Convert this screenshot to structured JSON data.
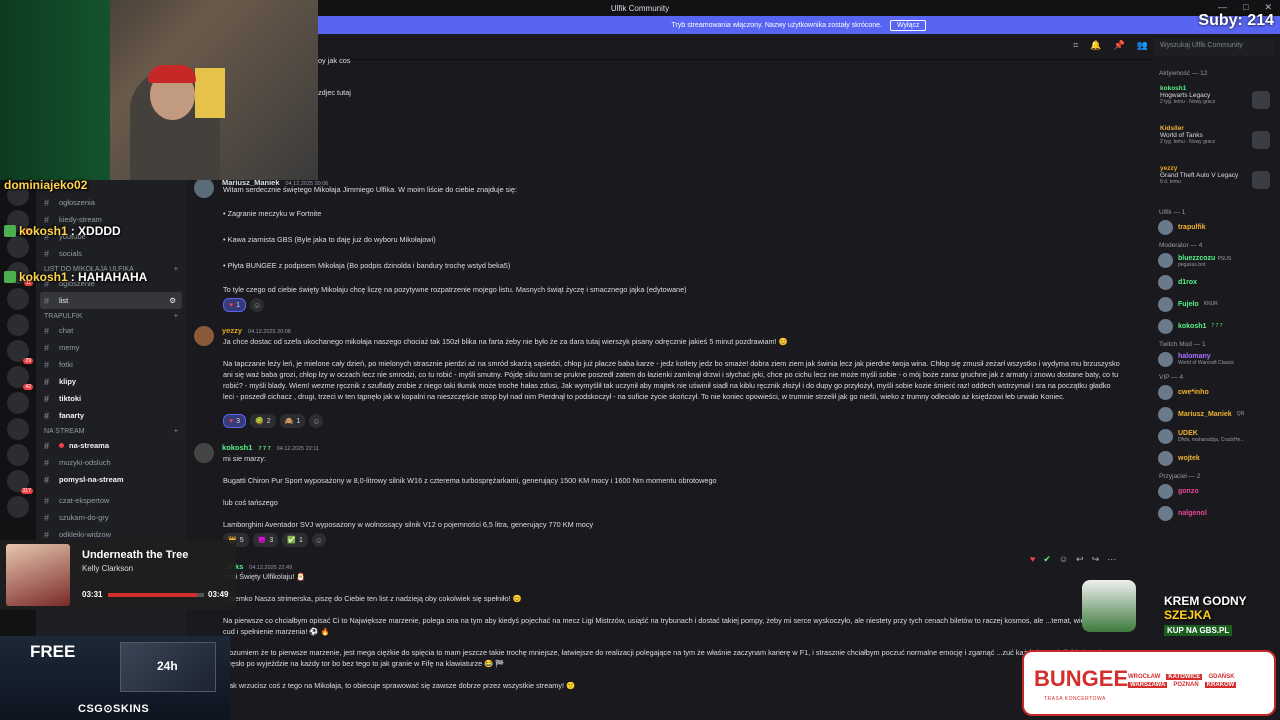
{
  "window": {
    "title": "Ulfik Community",
    "controls": [
      "—",
      "□",
      "✕"
    ]
  },
  "subs_counter": "Suby: 214",
  "stream_banner": {
    "text": "Tryb streamowania włączony. Nazwy użytkownika zostały skrócone.",
    "button": "Wyłącz"
  },
  "search": {
    "placeholder": "Wyszukaj Ulfik Community"
  },
  "top_fragments": [
    "oy jak cos",
    "zdjec tutaj"
  ],
  "channels": {
    "top_items": [
      {
        "label": "ogłoszenia"
      },
      {
        "label": "kiedy-stream"
      },
      {
        "label": "youtube"
      },
      {
        "label": "socials"
      }
    ],
    "cat_list": "LIST DO MIKOŁAJA ULFIKA",
    "list_items": [
      {
        "label": "ogloszenie",
        "active": false
      },
      {
        "label": "list",
        "active": true
      }
    ],
    "cat_trap": "TRAPULFIK",
    "trap_items": [
      {
        "label": "chat",
        "bold": false
      },
      {
        "label": "memy",
        "bold": false
      },
      {
        "label": "fotki",
        "bold": false
      },
      {
        "label": "klipy",
        "bold": true
      },
      {
        "label": "tiktoki",
        "bold": true
      },
      {
        "label": "fanarty",
        "bold": true
      }
    ],
    "cat_stream": "NA STREAM",
    "stream_items": [
      {
        "label": "na-streama",
        "bold": true
      },
      {
        "label": "muzyki-odsluch",
        "bold": false
      },
      {
        "label": "pomysl-na-stream",
        "bold": true
      }
    ],
    "bottom_items": [
      {
        "label": "czat-ekspertow"
      },
      {
        "label": "szukam-do-gry"
      },
      {
        "label": "odkleiki-widzow"
      }
    ]
  },
  "stream_chat": [
    {
      "name": "dominiajeko02",
      "text": ""
    },
    {
      "name": "kokosh1",
      "text": ": XDDDD"
    },
    {
      "name": "kokosh1",
      "text": ": HAHAHAHA"
    }
  ],
  "messages": [
    {
      "author": "Mariusz_Maniek",
      "time": "04.12.2025 20:06",
      "color": "#dbdee1",
      "lines": [
        "Witam serdecznie świętego Mikołaja Jimmiego Ulfika. W moim liście do ciebie znajduje się:",
        "•   Zagranie meczyku w Fortnite",
        "•   Kawa ziarnista GBS (Byle jaka to daję już do wyboru Mikołajowi)",
        "•   Płyta BUNGEE z podpisem Mikołaja (Bo podpis dzinolda i bandury trochę wstyd beka5)",
        "To tyle czego od ciebie święty Mikołaju chcę liczę na pozytywne rozpatrzenie mojego listu. Masnych świąt życzę i smacznego jajka (edytowane)"
      ],
      "reactions": [
        {
          "emoji": "♥",
          "count": "1",
          "selected": true
        }
      ]
    },
    {
      "author": "yezzy",
      "time": "04.12.2025 20:08",
      "color": "#e6a817",
      "lines": [
        "Ja chce dostac od szefa ukochanego mikołaja naszego chociaż tak 150zł blika na farta żeby nie było że za dara tutaj wierszyk pisany odręcznie jakieś 5 minut pozdrawiam! 😊",
        "Na tapczanie leży leń, je mielone cały dzień, po mielonych strasznie pierdzi aż na smród skarżą sąsiedzi, chłop już płacze baba karze - jedz kotlety jedz bo smaże! dobra ziem ziem jak świnia lecz jak pierdne twoja wina. Chłop się zmusił zeżarł wszystko i wydyma mu brzuszysko ani się waż baba grozi, chłop łzy w oczach lecz nie smrodzi, co tu robić - myśli smutny. Pójdę siku tam se prukne poszedł zatem do łazienki zamknął drzwi i słychać jęki, chce po cichu lecz nie może myśli sobie - o mój boże zaraz gruchne jak z armaty i znowu dostane baty, co tu robić? - myśli blady. Wiem! wezme ręcznik z szuflady zrobie z niego taki tłumik może troche hałas zdusi, Jak wymyślił tak uczynił aby majtek nie uświnił siadł na kiblu ręcznik złożył i do dupy go przyłożył, myśli sobie kozie śmierć raz! oddech wstrzymał i sra na początku gładko leci - poszedł cichacz , drugi, trzeci w ten tąpnęło jak w kopalni na nieszczęście strop był nad nim Pierdnął to podskoczył - na suficie życie skończył. To nie koniec opowieści, w trumnie strzelił jak go nieśli, wieko z trumny odleciało aż księdzowi łeb urwało Koniec."
      ],
      "reactions": [
        {
          "emoji": "♥",
          "count": "3",
          "selected": true
        },
        {
          "emoji": "🥝",
          "count": "2",
          "selected": false
        },
        {
          "emoji": "🙈",
          "count": "1",
          "selected": false
        }
      ]
    },
    {
      "author": "kokosh1",
      "time": "04.12.2025 22:11",
      "color": "#57f287",
      "badge": "7 7 7",
      "lines": [
        "mi sie marzy:",
        "Bugatti Chiron Pur Sport wyposażony w 8,0-litrowy silnik W16 z czterema turbosprężarkami, generujący 1500 KM mocy i 1600 Nm momentu obrotowego",
        "lub coś tańszego",
        "Lamborghini Aventador SVJ wyposażony w wolnossący silnik V12 o pojemności 6,5 litra, generujący 770 KM mocy"
      ],
      "reactions": [
        {
          "emoji": "👑",
          "count": "5",
          "selected": false
        },
        {
          "emoji": "😈",
          "count": "3",
          "selected": false
        },
        {
          "emoji": "✅",
          "count": "1",
          "selected": false
        }
      ]
    },
    {
      "author": "...inks",
      "time": "04.12.2025 22:49",
      "color": "#57f287",
      "lines": [
        "...roi Święty Ulfikolaju! 🎅",
        "...ałemko Nasza strimerska, piszę do Ciebie ten list z nadzieją oby cokolwiek się spełniło! 😊",
        "Na pierwsze co chciałbym opisać Ci to Największe marzenie, polega ona na tym aby kiedyś pojechać na mecz Ligi Mistrzów, usiąść na trybunach i dostać takiej pompy, żeby mi serce wyskoczyło, ale niestety przy tych cenach biletów to raczej kosmos, ale ...temat, więc liczę na cud i spełnienie marzenia! ⚽ 🔥",
        "...ozumiem że to pierwsze marzenie, jest mega ciężkie do spięcia to mam jeszcze takie trochę mniejsze, łatwiejsze do realizacji polegające na tym że właśnie zaczynam karierę w F1, i strasznie chciałbym poczuć normalne emocję i zgarnąć ...zuć każdy krawężnik i żeby mi ręce trzęsło po wyjeździe na każdy tor bo bez tego to jak granie w Fifę na klawiaturze 😂 🏁",
        "...ak wrzucisz coś z tego na Mikołaja, to obiecuje sprawować się zawsze dobrze przez wszystkie streamy! 🙂"
      ],
      "reactions": []
    }
  ],
  "members": {
    "activity_header": "Aktywność — 12",
    "activities": [
      {
        "user": "kokosh1",
        "game": "Hogwarts Legacy",
        "meta": "2 tyg. temu · Nowy gracz"
      },
      {
        "user": "Kidsller",
        "game": "World of Tanks",
        "meta": "2 tyg. temu · Nowy gracz"
      },
      {
        "user": "yezzy",
        "game": "Grand Theft Auto V Legacy",
        "meta": "8 d. temu"
      }
    ],
    "sections": [
      {
        "title": "Ulfik — 1",
        "items": [
          {
            "name": "trapulfik",
            "color": "#f0b232",
            "sub": ""
          }
        ]
      },
      {
        "title": "Moderator — 4",
        "items": [
          {
            "name": "bluezzcozu",
            "color": "#57f287",
            "sub": "pegasus.bot",
            "tag": "PSUS"
          },
          {
            "name": "d1rox",
            "color": "#57f287",
            "sub": ""
          },
          {
            "name": "Fujelo",
            "color": "#57f287",
            "sub": "",
            "tag": "KNUR"
          },
          {
            "name": "kokosh1",
            "color": "#57f287",
            "sub": "",
            "tag": "7 7 7"
          }
        ]
      },
      {
        "title": "Twitch Mod — 1",
        "items": [
          {
            "name": "halomany",
            "color": "#a970ff",
            "sub": "World of Warcraft Classic"
          }
        ]
      },
      {
        "title": "VIP — 4",
        "items": [
          {
            "name": "cwe*inho",
            "color": "#f0b232",
            "sub": ""
          },
          {
            "name": "Mariusz_Maniek",
            "color": "#f0b232",
            "sub": "",
            "tag": "QŃ"
          },
          {
            "name": "UDEK",
            "color": "#f0b232",
            "sub": "Dfvls, maharadzja, CrackHe..."
          },
          {
            "name": "wojtek",
            "color": "#f0b232",
            "sub": ""
          }
        ]
      },
      {
        "title": "Przyjaciel — 2",
        "items": [
          {
            "name": "gonzo",
            "color": "#eb459e",
            "sub": ""
          },
          {
            "name": "nalgenol",
            "color": "#eb459e",
            "sub": ""
          }
        ]
      }
    ]
  },
  "music": {
    "song": "Underneath the Tree",
    "artist": "Kelly Clarkson",
    "current": "03:31",
    "total": "03:49",
    "progress": 0.93
  },
  "ads": {
    "csg_free": "FREE",
    "csg_brand": "CSG⊙SKINS",
    "csg_box": "24h",
    "gbs_1": "KREM GODNY",
    "gbs_2": "SZEJKA",
    "gbs_3": "KUP NA GBS.PL",
    "bungee_logo": "BUNGEE",
    "bungee_tour": "TRASA KONCERTOWA",
    "bungee_cities": [
      "WROCŁAW",
      "KATOWICE",
      "GDAŃSK",
      "WARSZAWA",
      "POZNAŃ",
      "KRAKÓW"
    ]
  },
  "colors": {
    "accent": "#5865f2",
    "bg": "#1a1a1e",
    "sidebar": "#1e1f22"
  }
}
